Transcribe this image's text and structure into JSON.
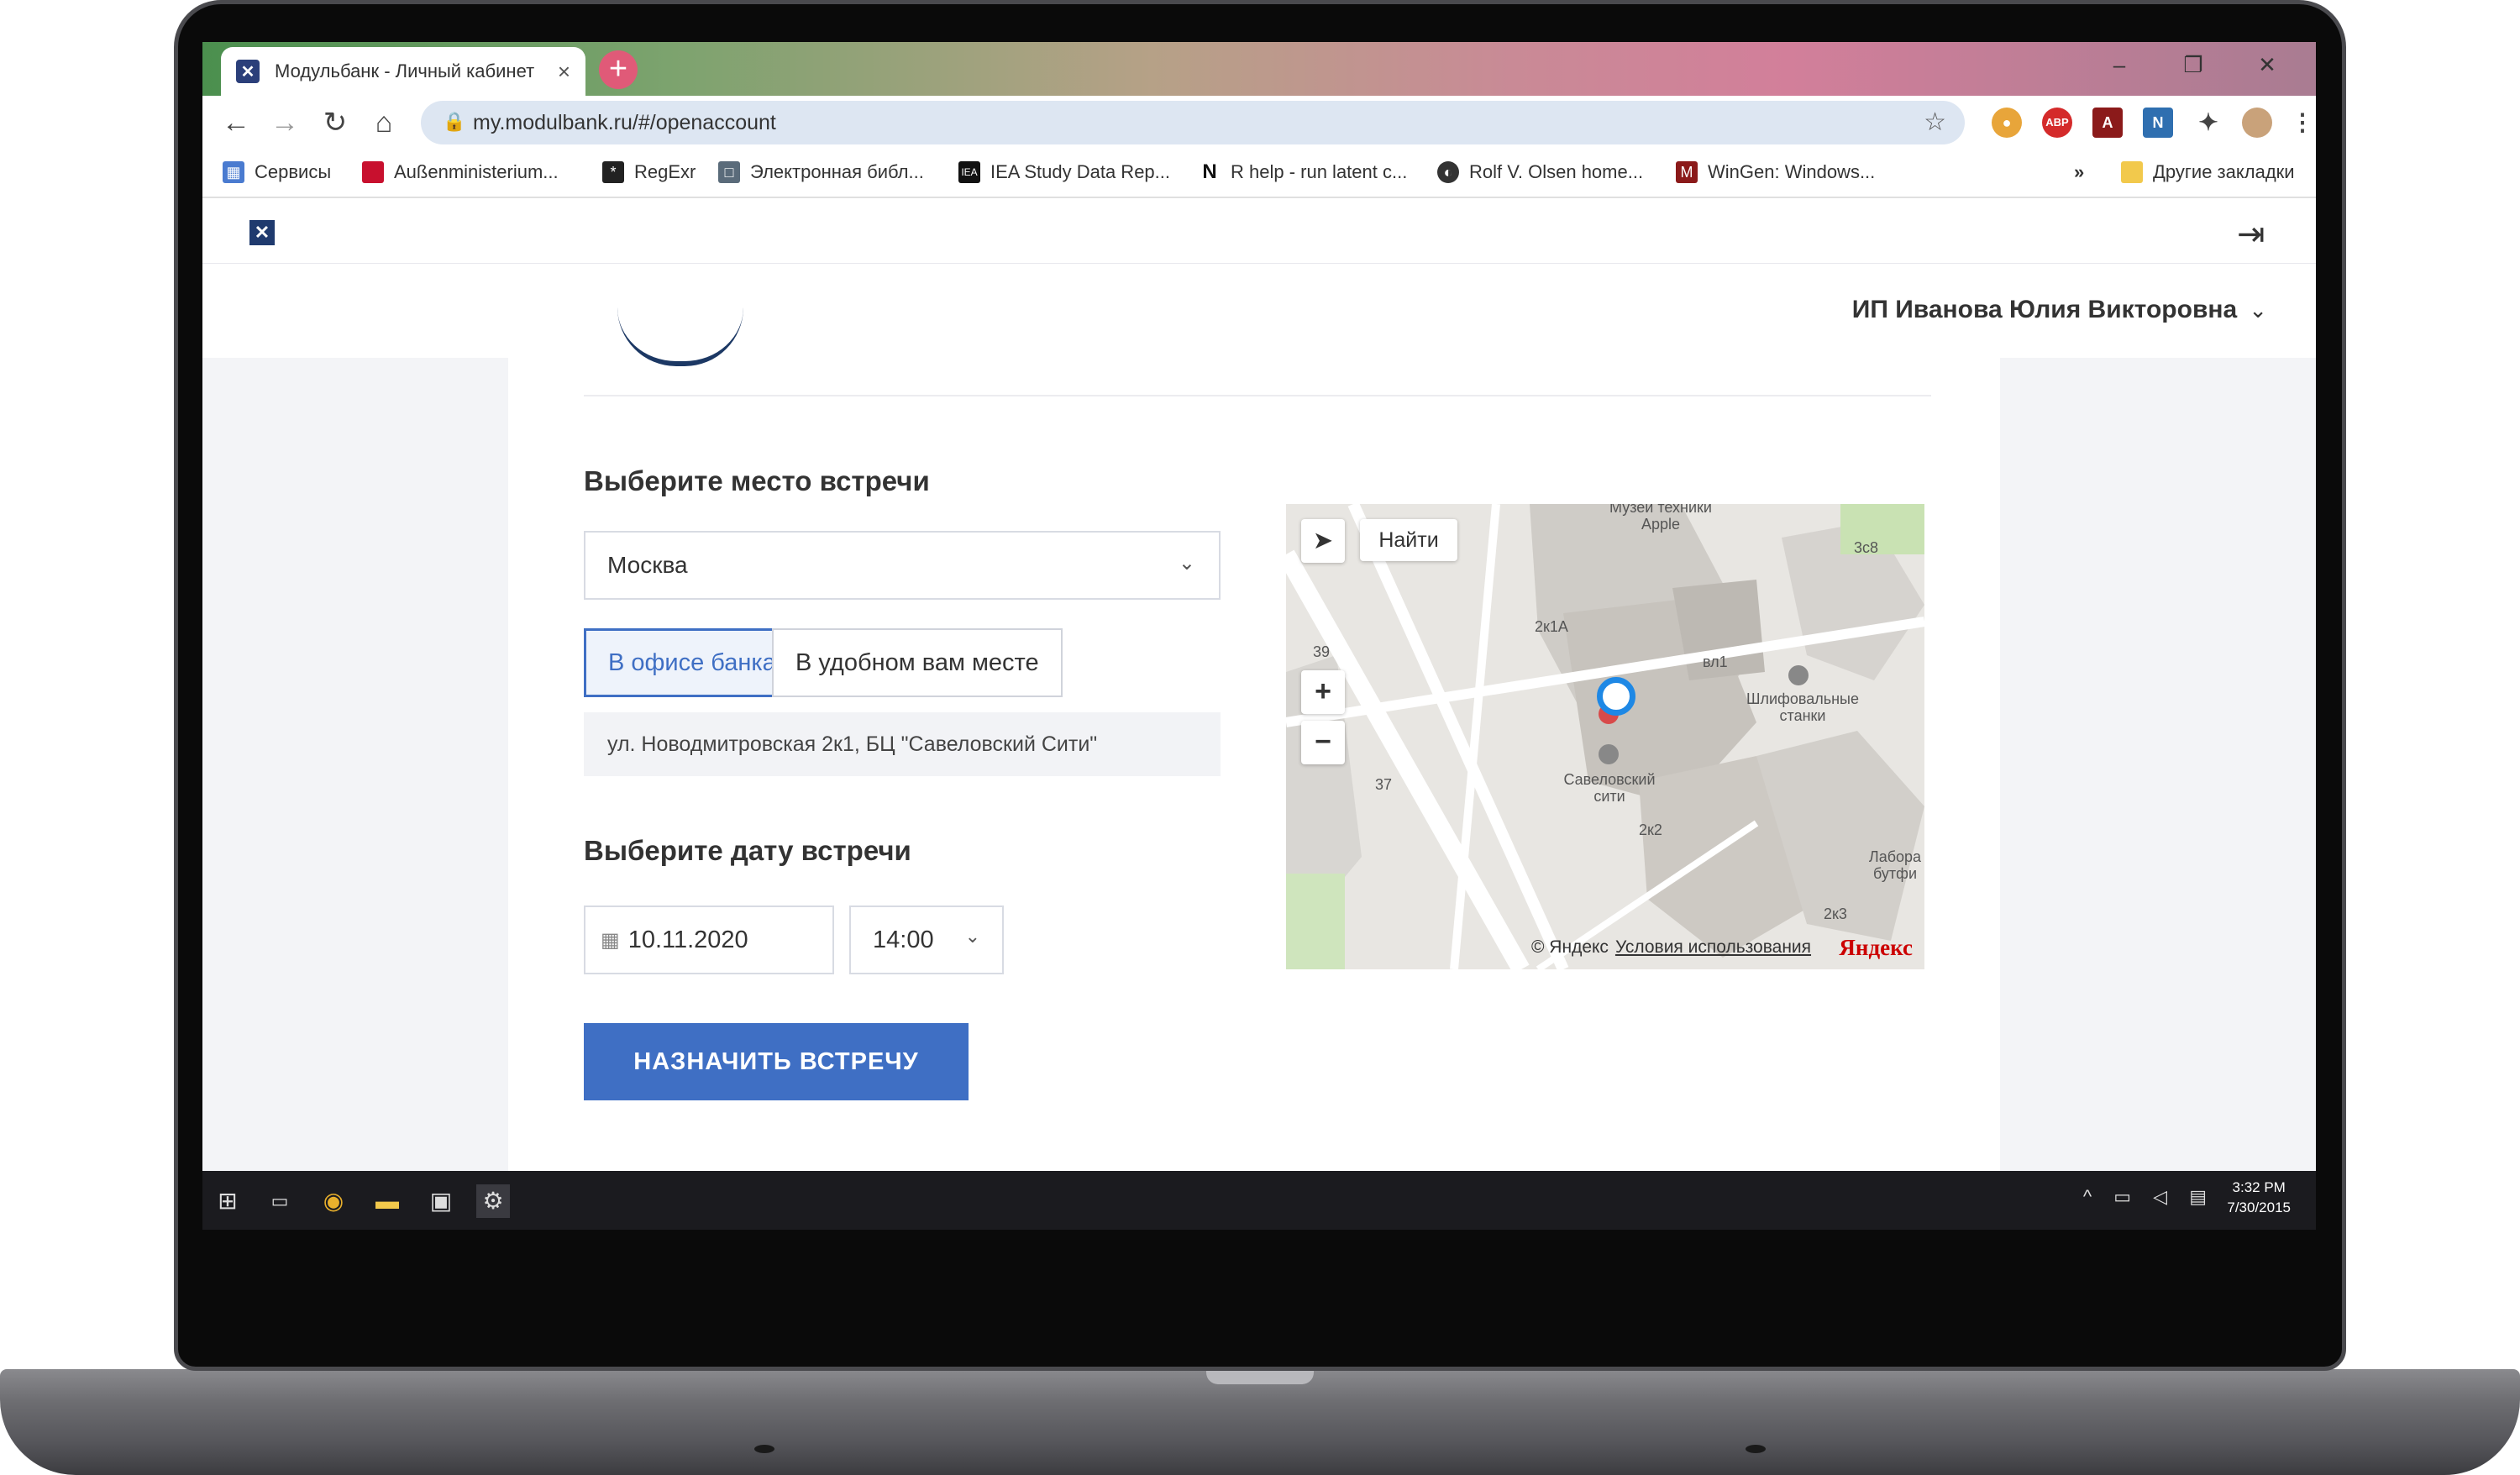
{
  "browser": {
    "tab_title": "Модульбанк - Личный кабинет",
    "url": "my.modulbank.ru/#/openaccount",
    "bookmarks": [
      "Сервисы",
      "Außenministerium...",
      "RegExr",
      "Электронная библ...",
      "IEA Study Data Rep...",
      "R help - run latent c...",
      "Rolf V. Olsen home...",
      "WinGen: Windows...",
      "Другие закладки"
    ],
    "more_bookmarks": "»",
    "theme_colors": [
      "#4b8f4e",
      "#c98a96",
      "#d27f9a"
    ]
  },
  "app": {
    "user_name": "ИП Иванова Юлия Викторовна",
    "brand_color": "#1f3a6e",
    "accent_color": "#3f6fc4"
  },
  "form": {
    "place_label": "Выберите место встречи",
    "city_value": "Москва",
    "option_office": "В офисе банка",
    "option_custom": "В удобном вам месте",
    "address": "ул. Новодмитровская 2к1, БЦ \"Савеловский Сити\"",
    "date_label": "Выберите дату встречи",
    "date_value": "10.11.2020",
    "time_value": "14:00",
    "submit_label": "НАЗНАЧИТЬ ВСТРЕЧУ"
  },
  "map": {
    "find_label": "Найти",
    "copyright": "© Яндекс",
    "terms": "Условия использования",
    "brand": "Яндекс",
    "poi": [
      "Музей техники Apple",
      "Шлифовальные станки",
      "Савеловский сити",
      "Лабора бутфи"
    ],
    "house_numbers": [
      "2к1А",
      "вл1",
      "3с8",
      "39",
      "37",
      "2к2",
      "2к3"
    ]
  },
  "taskbar": {
    "time": "3:32 PM",
    "date": "7/30/2015"
  }
}
